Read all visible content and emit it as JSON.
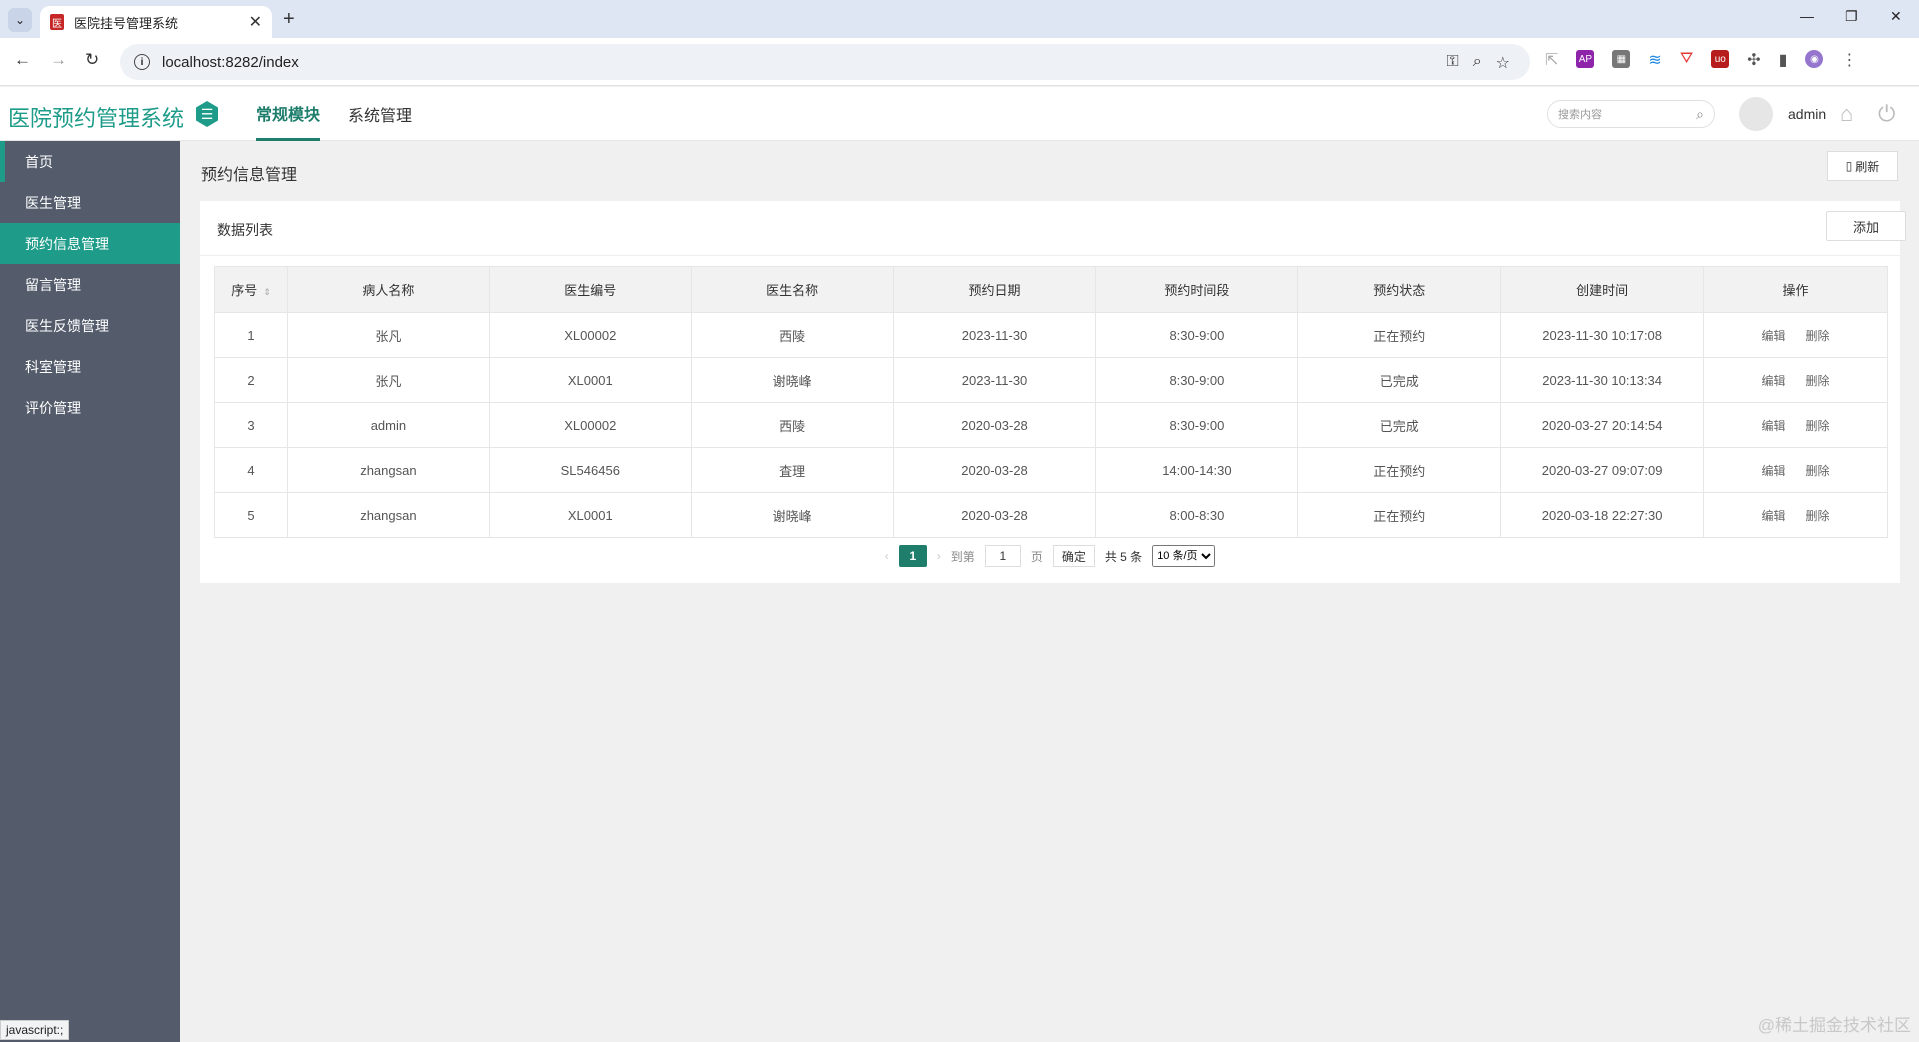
{
  "browser": {
    "tab_title": "医院挂号管理系统",
    "url": "localhost:8282/index",
    "status_text": "javascript:;"
  },
  "header": {
    "app_title": "医院预约管理系统",
    "nav": [
      "常规模块",
      "系统管理"
    ],
    "search_placeholder": "搜索内容",
    "user_name": "admin"
  },
  "sidebar": {
    "items": [
      "首页",
      "医生管理",
      "预约信息管理",
      "留言管理",
      "医生反馈管理",
      "科室管理",
      "评价管理"
    ]
  },
  "main": {
    "page_title": "预约信息管理",
    "refresh_label": "刷新",
    "card_title": "数据列表",
    "add_label": "添加",
    "columns": [
      "序号",
      "病人名称",
      "医生编号",
      "医生名称",
      "预约日期",
      "预约时间段",
      "预约状态",
      "创建时间",
      "操作"
    ],
    "rows": [
      [
        "1",
        "张凡",
        "XL00002",
        "西陵",
        "2023-11-30",
        "8:30-9:00",
        "正在预约",
        "2023-11-30 10:17:08"
      ],
      [
        "2",
        "张凡",
        "XL0001",
        "谢晓峰",
        "2023-11-30",
        "8:30-9:00",
        "已完成",
        "2023-11-30 10:13:34"
      ],
      [
        "3",
        "admin",
        "XL00002",
        "西陵",
        "2020-03-28",
        "8:30-9:00",
        "已完成",
        "2020-03-27 20:14:54"
      ],
      [
        "4",
        "zhangsan",
        "SL546456",
        "査理",
        "2020-03-28",
        "14:00-14:30",
        "正在预约",
        "2020-03-27 09:07:09"
      ],
      [
        "5",
        "zhangsan",
        "XL0001",
        "谢晓峰",
        "2020-03-28",
        "8:00-8:30",
        "正在预约",
        "2020-03-18 22:27:30"
      ]
    ],
    "edit_label": "编辑",
    "delete_label": "删除",
    "pager": {
      "current": "1",
      "goto_label": "到第",
      "page_input": "1",
      "page_label": "页",
      "confirm_label": "确定",
      "total_label": "共 5 条",
      "page_size": "10 条/页"
    }
  },
  "watermark": "@稀土掘金技术社区"
}
